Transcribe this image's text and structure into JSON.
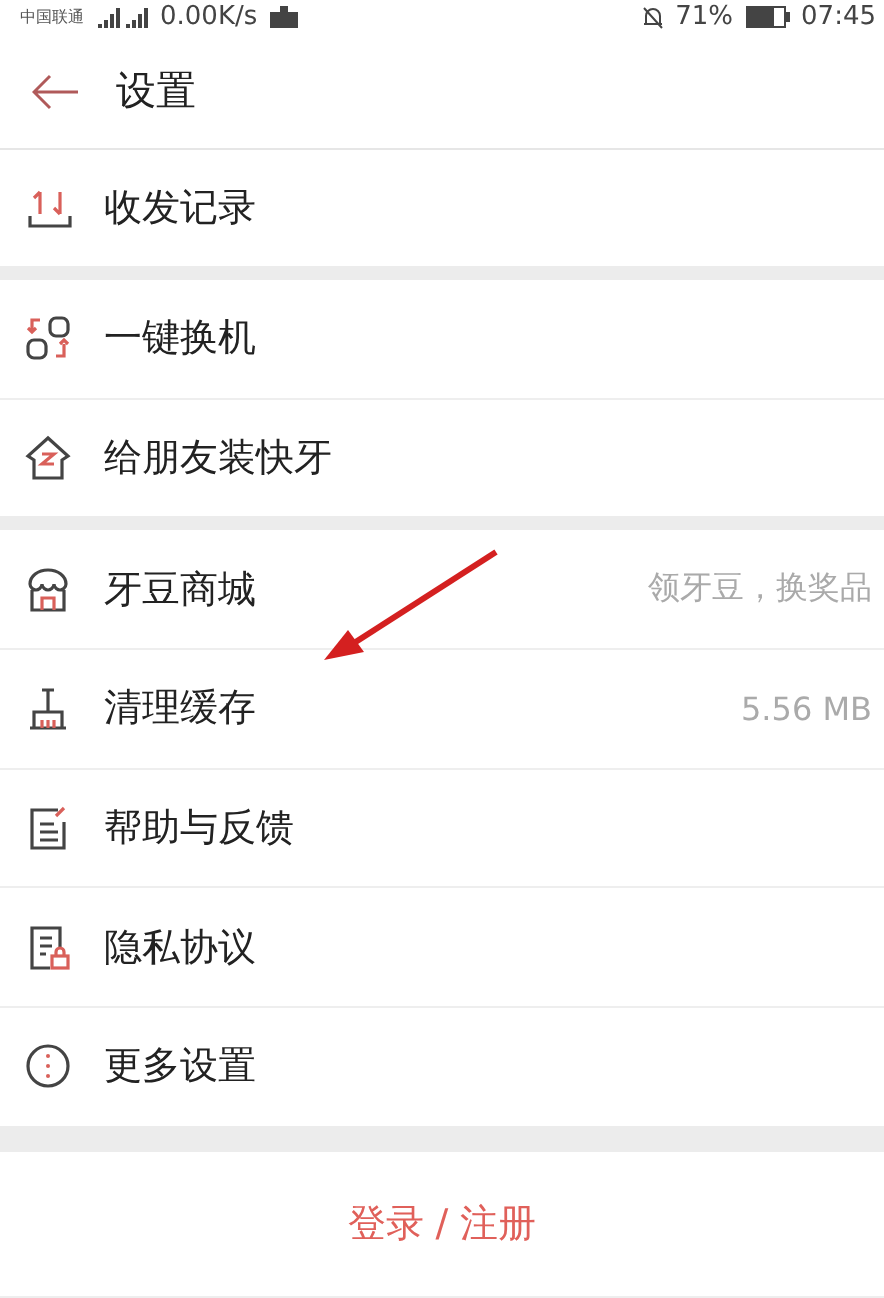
{
  "status_bar": {
    "carrier": "中国联通",
    "speed": "0.00K/s",
    "battery": "71%",
    "time": "07:45"
  },
  "header": {
    "title": "设置"
  },
  "sections": [
    {
      "items": [
        {
          "label": "收发记录"
        }
      ]
    },
    {
      "items": [
        {
          "label": "一键换机"
        },
        {
          "label": "给朋友装快牙"
        }
      ]
    },
    {
      "items": [
        {
          "label": "牙豆商城",
          "hint": "领牙豆，换奖品"
        },
        {
          "label": "清理缓存",
          "hint": "5.56 MB"
        },
        {
          "label": "帮助与反馈"
        },
        {
          "label": "隐私协议"
        },
        {
          "label": "更多设置"
        }
      ]
    }
  ],
  "login_button": {
    "label": "登录 / 注册"
  }
}
